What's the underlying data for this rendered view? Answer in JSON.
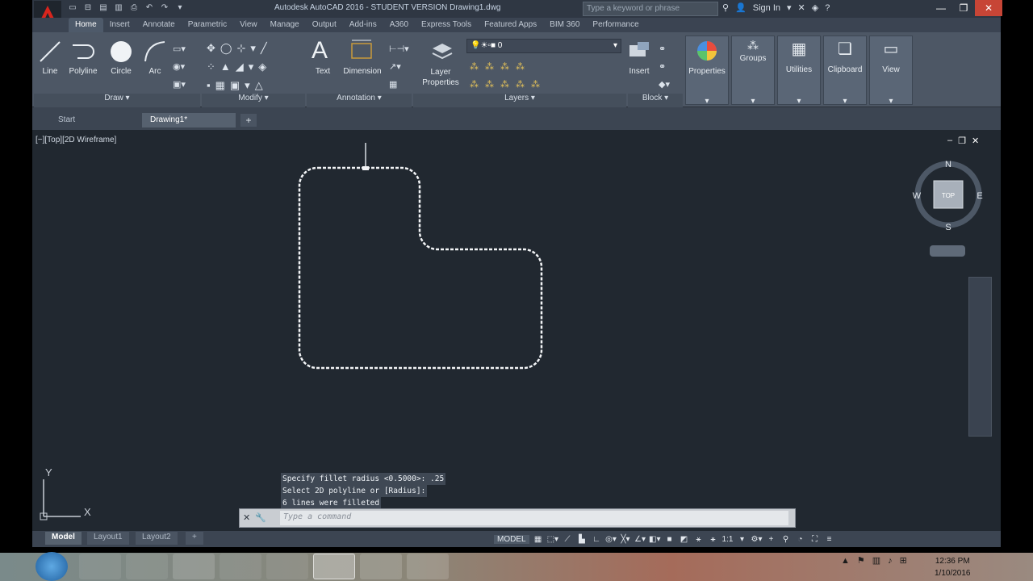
{
  "window": {
    "title": "Autodesk AutoCAD 2016 - STUDENT VERSION    Drawing1.dwg",
    "search_placeholder": "Type a keyword or phrase",
    "sign_in": "Sign In"
  },
  "ribbon_tabs": [
    "Home",
    "Insert",
    "Annotate",
    "Parametric",
    "View",
    "Manage",
    "Output",
    "Add-ins",
    "A360",
    "Express Tools",
    "Featured Apps",
    "BIM 360",
    "Performance"
  ],
  "ribbon": {
    "draw_tools": [
      "Line",
      "Polyline",
      "Circle",
      "Arc"
    ],
    "draw_panel": "Draw",
    "modify_panel": "Modify",
    "annotation_tools": [
      "Text",
      "Dimension"
    ],
    "annotation_panel": "Annotation",
    "layer_properties": "Layer Properties",
    "layer_current": "0",
    "layers_panel": "Layers",
    "insert": "Insert",
    "block_panel": "Block",
    "properties": "Properties",
    "groups": "Groups",
    "utilities": "Utilities",
    "clipboard": "Clipboard",
    "view": "View"
  },
  "doc_tabs": [
    "Start",
    "Drawing1*"
  ],
  "viewport": {
    "label": "[−][Top][2D Wireframe]",
    "viewcube": {
      "top": "TOP",
      "n": "N",
      "s": "S",
      "e": "E",
      "w": "W"
    }
  },
  "ucs": {
    "x": "X",
    "y": "Y"
  },
  "command": {
    "history": [
      "Specify fillet radius <0.5000>: .25",
      "Select 2D polyline or [Radius]:",
      "6 lines were filleted"
    ],
    "placeholder": "Type a command"
  },
  "layout_tabs": [
    "Model",
    "Layout1",
    "Layout2"
  ],
  "status": {
    "model": "MODEL",
    "scale": "1:1"
  },
  "clock": {
    "time": "12:36 PM",
    "date": "1/10/2016"
  }
}
